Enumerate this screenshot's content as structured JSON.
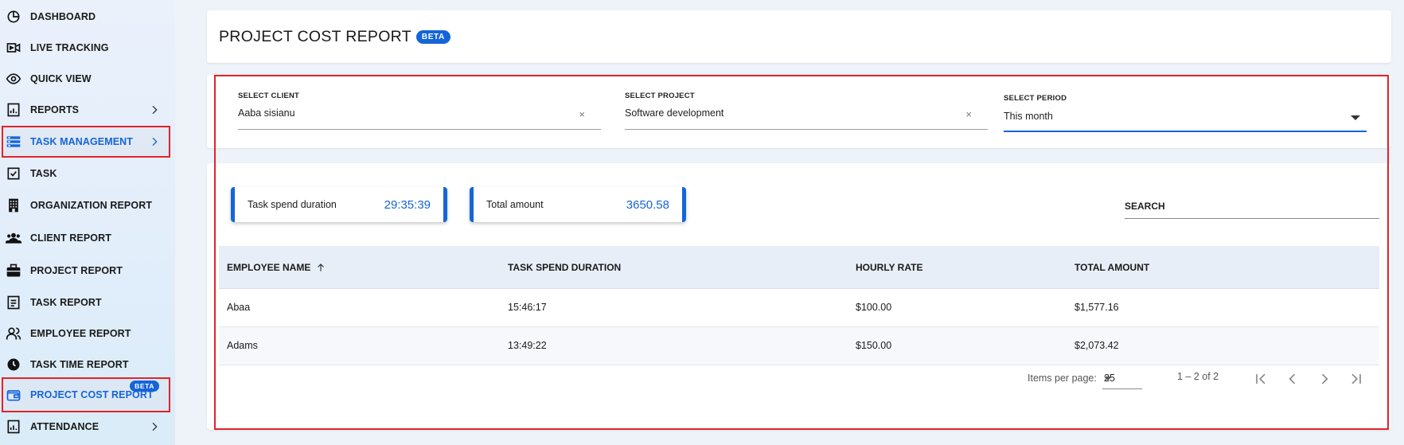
{
  "sidebar": {
    "items": [
      {
        "label": "DASHBOARD",
        "icon": "pie-chart-icon"
      },
      {
        "label": "LIVE TRACKING",
        "icon": "video-icon"
      },
      {
        "label": "QUICK VIEW",
        "icon": "eye-icon"
      },
      {
        "label": "REPORTS",
        "icon": "report-icon"
      },
      {
        "label": "TASK MANAGEMENT",
        "icon": "task-management-icon"
      },
      {
        "label": "TASK",
        "icon": "checkbox-icon"
      },
      {
        "label": "ORGANIZATION REPORT",
        "icon": "building-icon"
      },
      {
        "label": "CLIENT REPORT",
        "icon": "group-icon"
      },
      {
        "label": "PROJECT REPORT",
        "icon": "briefcase-icon"
      },
      {
        "label": "TASK REPORT",
        "icon": "document-icon"
      },
      {
        "label": "EMPLOYEE REPORT",
        "icon": "people-icon"
      },
      {
        "label": "TASK TIME REPORT",
        "icon": "clock-icon"
      },
      {
        "label": "PROJECT COST REPORT",
        "icon": "wallet-icon",
        "badge": "BETA"
      },
      {
        "label": "ATTENDANCE",
        "icon": "attendance-icon"
      }
    ]
  },
  "header": {
    "title": "PROJECT COST REPORT",
    "badge": "BETA"
  },
  "filters": {
    "client": {
      "label": "SELECT CLIENT",
      "value": "Aaba sisianu",
      "clear": "×"
    },
    "project": {
      "label": "SELECT PROJECT",
      "value": "Software development",
      "clear": "×"
    },
    "period": {
      "label": "SELECT PERIOD",
      "value": "This month"
    }
  },
  "stats": {
    "duration": {
      "label": "Task spend duration",
      "value": "29:35:39"
    },
    "amount": {
      "label": "Total amount",
      "value": "3650.58"
    }
  },
  "search": {
    "placeholder": "SEARCH"
  },
  "table": {
    "headers": {
      "employee": "EMPLOYEE NAME",
      "duration": "TASK SPEND DURATION",
      "rate": "HOURLY RATE",
      "total": "TOTAL AMOUNT"
    },
    "rows": [
      {
        "employee": "Abaa",
        "duration": "15:46:17",
        "rate": "$100.00",
        "total": "$1,577.16"
      },
      {
        "employee": "Adams",
        "duration": "13:49:22",
        "rate": "$150.00",
        "total": "$2,073.42"
      }
    ]
  },
  "paginator": {
    "items_label": "Items per page:",
    "page_size": "25",
    "range": "1 – 2 of 2"
  },
  "colors": {
    "accent": "#1565d8",
    "highlight_border": "#e0242a"
  }
}
